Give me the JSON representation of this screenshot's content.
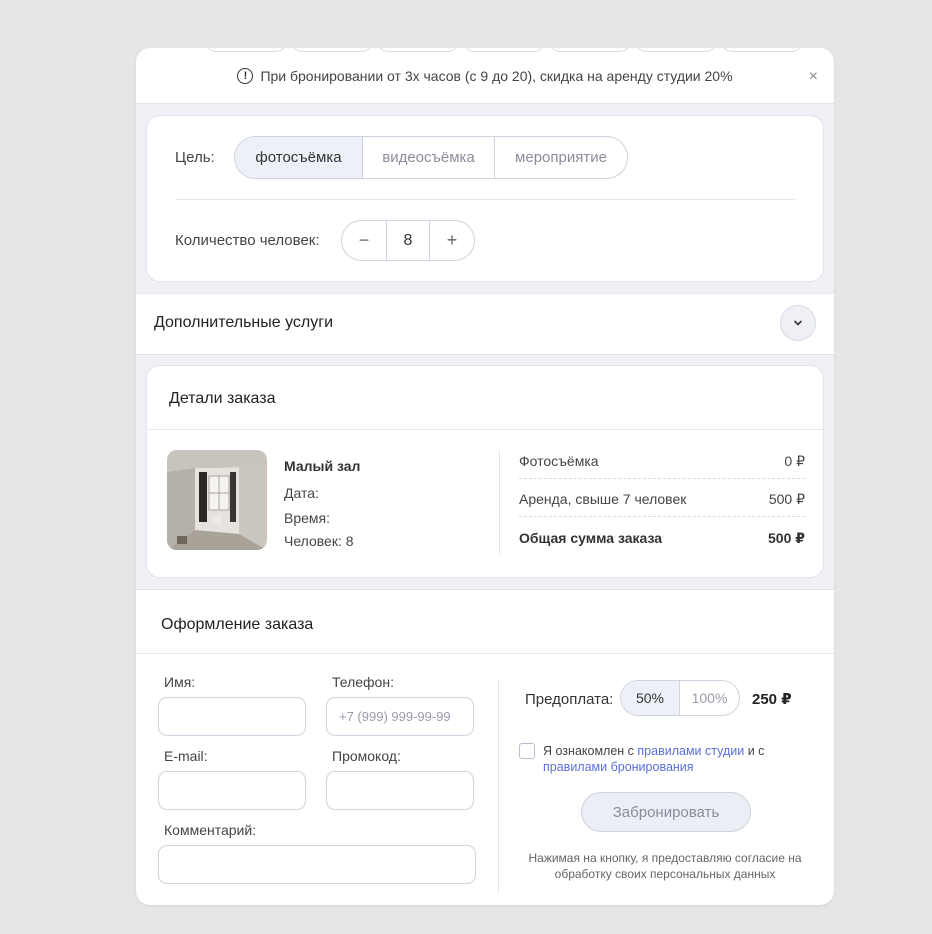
{
  "notice": {
    "text": "При бронировании от 3х часов (с 9 до 20), скидка на аренду студии 20%",
    "close": "×"
  },
  "purpose": {
    "label": "Цель:",
    "options": [
      "фотосъёмка",
      "видеосъёмка",
      "мероприятие"
    ],
    "selected": "фотосъёмка"
  },
  "people": {
    "label": "Количество человек:",
    "minus": "−",
    "value": "8",
    "plus": "+"
  },
  "extras": {
    "title": "Дополнительные услуги"
  },
  "order_details": {
    "title": "Детали заказа",
    "hall_name": "Малый зал",
    "date_label": "Дата:",
    "time_label": "Время:",
    "people_line": "Человек: 8",
    "summary": [
      {
        "label": "Фотосъёмка",
        "value": "0 ₽"
      },
      {
        "label": "Аренда, свыше 7 человек",
        "value": "500 ₽"
      }
    ],
    "total_label": "Общая сумма заказа",
    "total_value": "500 ₽"
  },
  "checkout": {
    "title": "Оформление заказа",
    "name_label": "Имя:",
    "phone_label": "Телефон:",
    "phone_placeholder": "+7 (999) 999-99-99",
    "email_label": "E-mail:",
    "promo_label": "Промокод:",
    "comment_label": "Комментарий:",
    "prepay_label": "Предоплата:",
    "prepay_options": [
      "50%",
      "100%"
    ],
    "prepay_selected": "50%",
    "prepay_amount": "250 ₽",
    "agree_prefix": "Я ознакомлен с ",
    "agree_link1": "правилами студии",
    "agree_mid": " и с ",
    "agree_link2": "правилами бронирования",
    "book_button": "Забронировать",
    "consent": "Нажимая на кнопку, я предоставляю согласие на обработку своих персональных данных"
  },
  "colors": {
    "accent_link": "#5a6ee0",
    "band": "#eff0f6",
    "selected": "#eef0f8"
  }
}
